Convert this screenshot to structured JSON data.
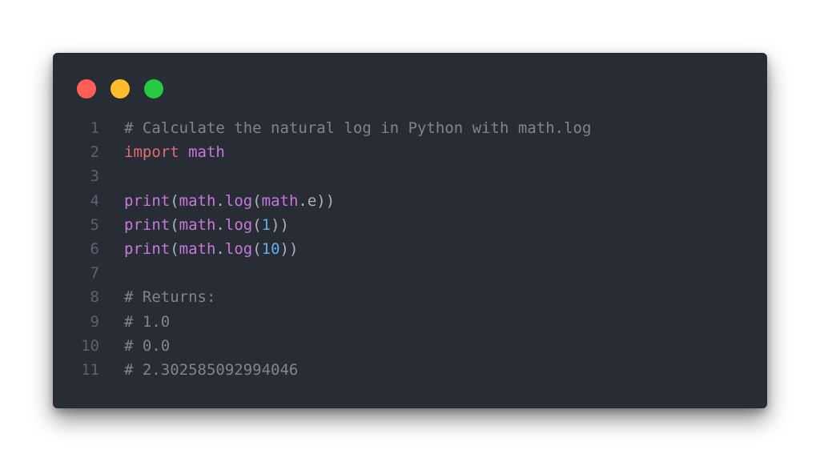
{
  "window": {
    "colors": {
      "background": "#282c34",
      "close": "#ff5f56",
      "minimize": "#ffbd2e",
      "maximize": "#27c93f"
    }
  },
  "code": {
    "lines": [
      {
        "number": "1",
        "tokens": [
          {
            "text": "# Calculate the natural log in Python with math.log",
            "type": "comment"
          }
        ]
      },
      {
        "number": "2",
        "tokens": [
          {
            "text": "import",
            "type": "keyword"
          },
          {
            "text": " ",
            "type": "plain"
          },
          {
            "text": "math",
            "type": "name"
          }
        ]
      },
      {
        "number": "3",
        "tokens": []
      },
      {
        "number": "4",
        "tokens": [
          {
            "text": "print",
            "type": "fn"
          },
          {
            "text": "(",
            "type": "plain"
          },
          {
            "text": "math",
            "type": "name"
          },
          {
            "text": ".",
            "type": "plain"
          },
          {
            "text": "log",
            "type": "fn"
          },
          {
            "text": "(",
            "type": "plain"
          },
          {
            "text": "math",
            "type": "name"
          },
          {
            "text": ".e))",
            "type": "plain"
          }
        ]
      },
      {
        "number": "5",
        "tokens": [
          {
            "text": "print",
            "type": "fn"
          },
          {
            "text": "(",
            "type": "plain"
          },
          {
            "text": "math",
            "type": "name"
          },
          {
            "text": ".",
            "type": "plain"
          },
          {
            "text": "log",
            "type": "fn"
          },
          {
            "text": "(",
            "type": "plain"
          },
          {
            "text": "1",
            "type": "num"
          },
          {
            "text": "))",
            "type": "plain"
          }
        ]
      },
      {
        "number": "6",
        "tokens": [
          {
            "text": "print",
            "type": "fn"
          },
          {
            "text": "(",
            "type": "plain"
          },
          {
            "text": "math",
            "type": "name"
          },
          {
            "text": ".",
            "type": "plain"
          },
          {
            "text": "log",
            "type": "fn"
          },
          {
            "text": "(",
            "type": "plain"
          },
          {
            "text": "10",
            "type": "num"
          },
          {
            "text": "))",
            "type": "plain"
          }
        ]
      },
      {
        "number": "7",
        "tokens": []
      },
      {
        "number": "8",
        "tokens": [
          {
            "text": "# Returns:",
            "type": "comment"
          }
        ]
      },
      {
        "number": "9",
        "tokens": [
          {
            "text": "# 1.0",
            "type": "comment"
          }
        ]
      },
      {
        "number": "10",
        "tokens": [
          {
            "text": "# 0.0",
            "type": "comment"
          }
        ]
      },
      {
        "number": "11",
        "tokens": [
          {
            "text": "# 2.302585092994046",
            "type": "comment"
          }
        ]
      }
    ]
  }
}
